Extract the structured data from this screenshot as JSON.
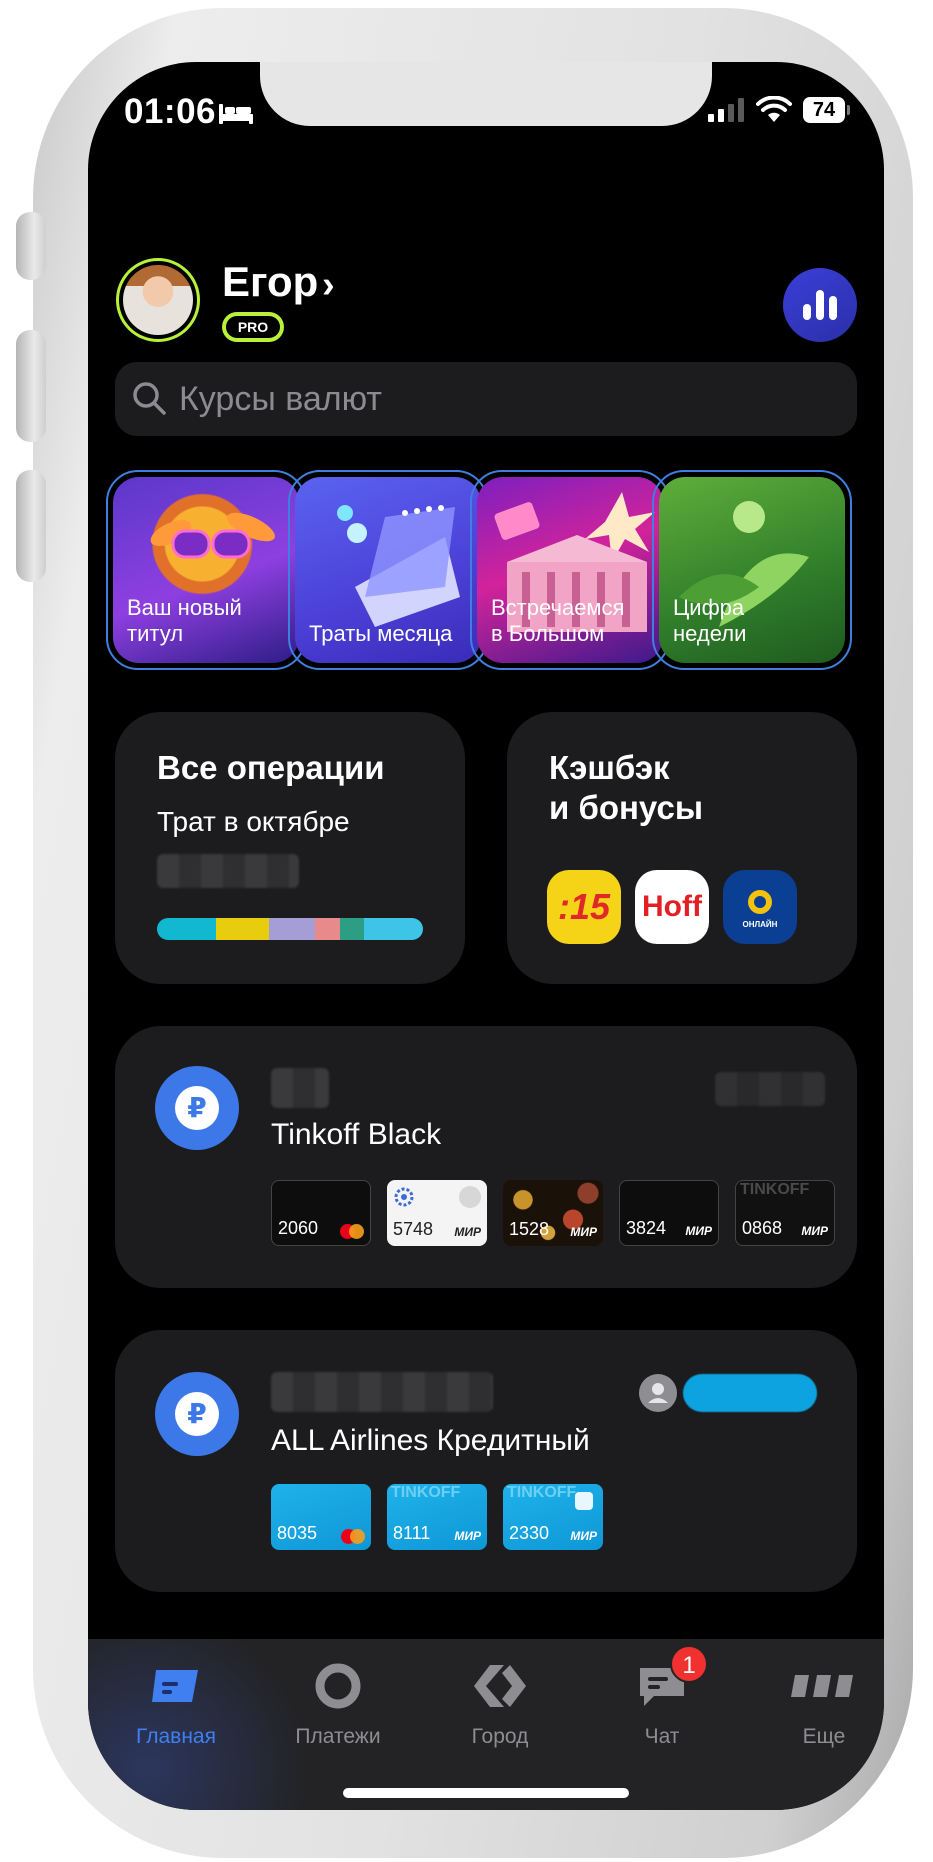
{
  "status_bar": {
    "time": "01:06",
    "battery": "74"
  },
  "header": {
    "user_name": "Егор",
    "badge": "PRO"
  },
  "search": {
    "placeholder": "Курсы валют"
  },
  "stories": [
    {
      "label": "Ваш новый\nтитул"
    },
    {
      "label": "Траты месяца"
    },
    {
      "label": "Встречаемся\nв Большом"
    },
    {
      "label": "Цифра\nнедели"
    }
  ],
  "operations": {
    "title": "Все операции",
    "subtitle": "Трат в октябре",
    "bar_colors": [
      "#11b8cf",
      "#e8cc0e",
      "#a59dd6",
      "#e88a8c",
      "#2c9e84",
      "#3ec4e6"
    ]
  },
  "cashback": {
    "title": "Кэшбэк\nи бонусы",
    "partners": [
      {
        "text": ":15",
        "bg": "#f5d316",
        "fg": "#e2272b"
      },
      {
        "text": "Hoff",
        "bg": "#ffffff",
        "fg": "#e31f26"
      },
      {
        "text": "ОНЛАЙН",
        "bg": "#0a3f93",
        "fg": "#ffffff"
      }
    ]
  },
  "accounts": [
    {
      "name": "Tinkoff Black",
      "currency_symbol": "₽",
      "cards": [
        {
          "number": "2060",
          "network": "mastercard",
          "style": "black"
        },
        {
          "number": "5748",
          "network": "МИР",
          "style": "white"
        },
        {
          "number": "1528",
          "network": "МИР",
          "style": "pattern"
        },
        {
          "number": "3824",
          "network": "МИР",
          "style": "black"
        },
        {
          "number": "0868",
          "network": "МИР",
          "style": "black-logo",
          "logo": "TINKOFF"
        }
      ]
    },
    {
      "name": "ALL Airlines Кредитный",
      "currency_symbol": "₽",
      "cards": [
        {
          "number": "8035",
          "network": "mastercard",
          "style": "blue"
        },
        {
          "number": "8111",
          "network": "МИР",
          "style": "blue-logo",
          "logo": "TINKOFF"
        },
        {
          "number": "2330",
          "network": "МИР",
          "style": "blue-logo",
          "logo": "TINKOFF"
        }
      ]
    }
  ],
  "tabbar": {
    "tabs": [
      {
        "label": "Главная",
        "active": true
      },
      {
        "label": "Платежи",
        "active": false
      },
      {
        "label": "Город",
        "active": false
      },
      {
        "label": "Чат",
        "active": false,
        "badge": "1"
      },
      {
        "label": "Еще",
        "active": false
      }
    ]
  },
  "colors": {
    "accent": "#3f7ff0",
    "pro_green": "#b8f03a",
    "surface": "#1c1c1e"
  }
}
